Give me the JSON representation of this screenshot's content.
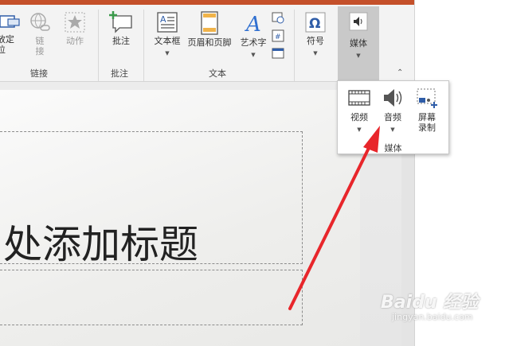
{
  "ribbon": {
    "groups": {
      "links": "链接",
      "comments": "批注",
      "text": "文本"
    },
    "buttons": {
      "zoom_partial": "放定\n位",
      "link": "链\n接",
      "action": "动作",
      "comment": "批注",
      "textbox": "文本框",
      "header_footer": "页眉和页脚",
      "wordart": "艺术字",
      "symbol": "符号",
      "media": "媒体"
    }
  },
  "media_dropdown": {
    "video": "视频",
    "audio": "音频",
    "screen_record": "屏幕\n录制",
    "group_label": "媒体"
  },
  "slide": {
    "title_placeholder": "处添加标题"
  },
  "watermark": {
    "brand": "Baidu 经验",
    "url": "jingyan.baidu.com"
  },
  "colors": {
    "title_bar": "#c4502a",
    "arrow": "#e8262b",
    "accent_blue": "#2f5da8"
  }
}
